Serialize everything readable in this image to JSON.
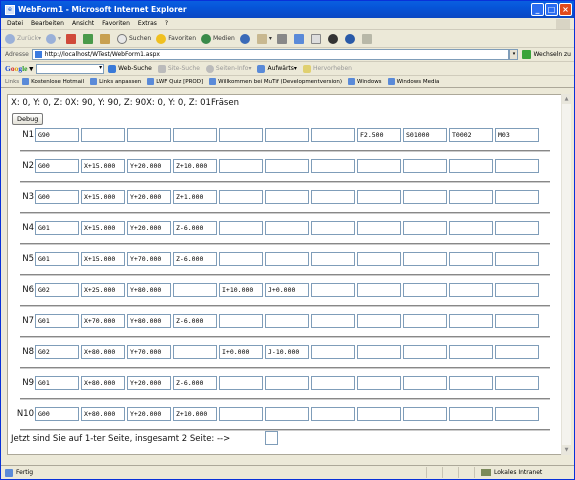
{
  "window": {
    "title": "WebForm1 - Microsoft Internet Explorer"
  },
  "menu": [
    "Datei",
    "Bearbeiten",
    "Ansicht",
    "Favoriten",
    "Extras",
    "?"
  ],
  "toolbar": {
    "back": "Zurück",
    "search": "Suchen",
    "favorites": "Favoriten",
    "media": "Medien"
  },
  "address": {
    "label": "Adresse",
    "url": "http://localhost/WTest/WebForm1.aspx",
    "go": "Wechseln zu"
  },
  "google": {
    "logo": [
      "G",
      "o",
      "o",
      "g",
      "le"
    ],
    "websearch": "Web-Suche",
    "sitesearch": "Site-Suche",
    "pageinfo": "Seiten-Info",
    "up": "Aufwärts",
    "highlight": "Hervorheben"
  },
  "links": {
    "label": "Links",
    "items": [
      "Kostenlose Hotmail",
      "Links anpassen",
      "LWF Quiz [PROD]",
      "Willkommen bei MuTif (Developmentversion)",
      "Windows",
      "Windows Media"
    ]
  },
  "page": {
    "coords": "X: 0, Y: 0, Z: 0X: 90, Y: 90, Z: 90X: 0, Y: 0, Z: 01Fräsen",
    "debug_label": "Debug",
    "rows": [
      {
        "label": "N1",
        "cells": [
          "G90",
          "",
          "",
          "",
          "",
          "",
          "",
          "F2.500",
          "S01000",
          "T0002",
          "M03"
        ]
      },
      {
        "label": "N2",
        "cells": [
          "G00",
          "X+15.000",
          "Y+20.000",
          "Z+10.000",
          "",
          "",
          "",
          "",
          "",
          "",
          ""
        ]
      },
      {
        "label": "N3",
        "cells": [
          "G00",
          "X+15.000",
          "Y+20.000",
          "Z+1.000",
          "",
          "",
          "",
          "",
          "",
          "",
          ""
        ]
      },
      {
        "label": "N4",
        "cells": [
          "G01",
          "X+15.000",
          "Y+20.000",
          "Z-6.000",
          "",
          "",
          "",
          "",
          "",
          "",
          ""
        ]
      },
      {
        "label": "N5",
        "cells": [
          "G01",
          "X+15.000",
          "Y+70.000",
          "Z-6.000",
          "",
          "",
          "",
          "",
          "",
          "",
          ""
        ]
      },
      {
        "label": "N6",
        "cells": [
          "G02",
          "X+25.000",
          "Y+80.000",
          "",
          "I+10.000",
          "J+0.000",
          "",
          "",
          "",
          "",
          ""
        ]
      },
      {
        "label": "N7",
        "cells": [
          "G01",
          "X+70.000",
          "Y+80.000",
          "Z-6.000",
          "",
          "",
          "",
          "",
          "",
          "",
          ""
        ]
      },
      {
        "label": "N8",
        "cells": [
          "G02",
          "X+80.000",
          "Y+70.000",
          "",
          "I+0.000",
          "J-10.000",
          "",
          "",
          "",
          "",
          ""
        ]
      },
      {
        "label": "N9",
        "cells": [
          "G01",
          "X+80.000",
          "Y+20.000",
          "Z-6.000",
          "",
          "",
          "",
          "",
          "",
          "",
          ""
        ]
      },
      {
        "label": "N10",
        "cells": [
          "G00",
          "X+80.000",
          "Y+20.000",
          "Z+10.000",
          "",
          "",
          "",
          "",
          "",
          "",
          ""
        ]
      }
    ],
    "footer_text": "Jetzt sind Sie auf 1-ter Seite, insgesamt 2 Seite: -->",
    "page_input": ""
  },
  "status": {
    "left": "Fertig",
    "zone": "Lokales Intranet"
  }
}
